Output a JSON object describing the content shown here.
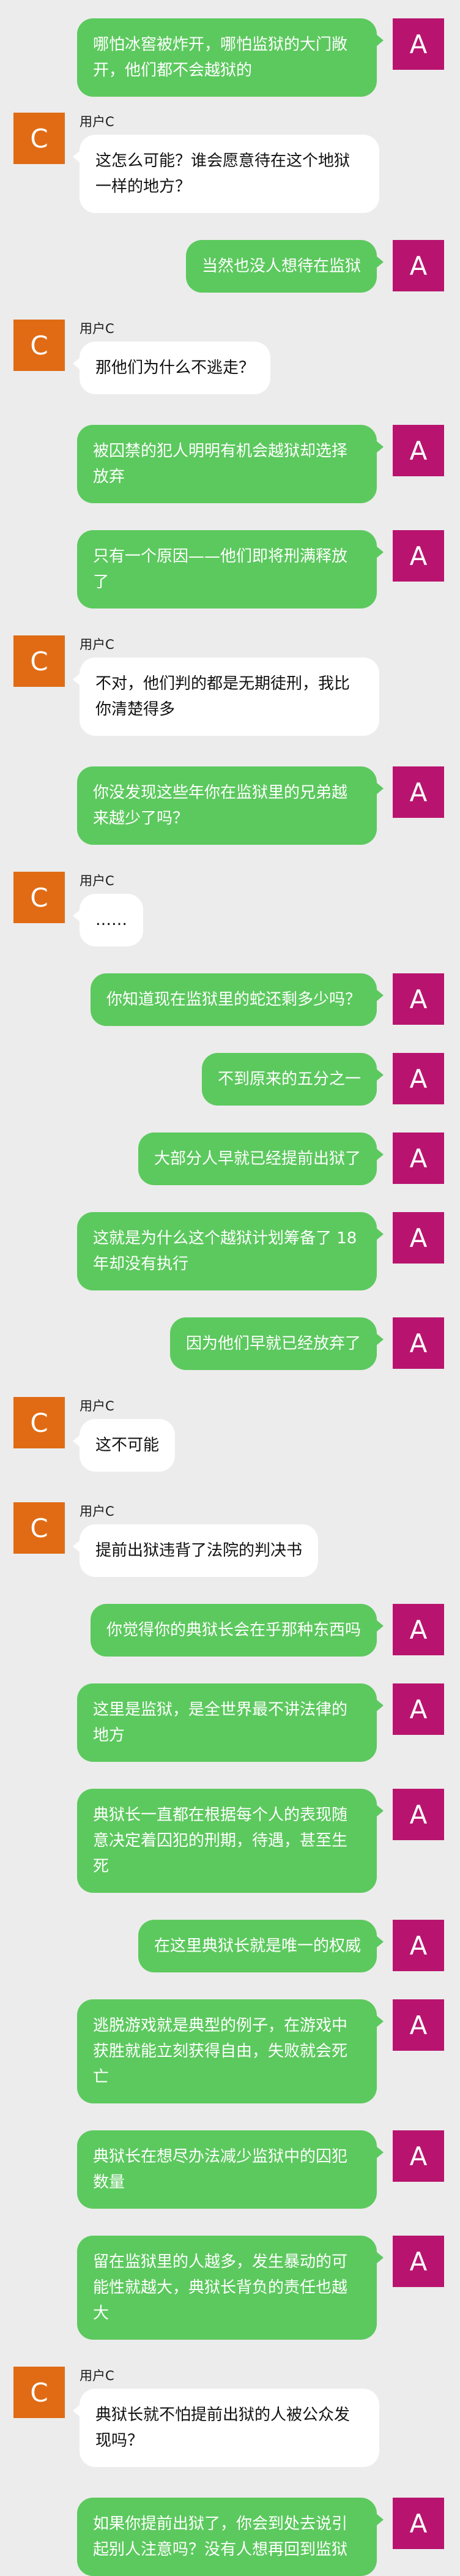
{
  "colors": {
    "background": "#ececec",
    "right_bubble": "#5cc95e",
    "left_bubble": "#ffffff",
    "avatar_a": "#b8146f",
    "avatar_c": "#e06b14"
  },
  "messages": [
    {
      "side": "right",
      "avatar": "A",
      "text": "哪怕冰窖被炸开，哪怕监狱的大门敞开，他们都不会越狱的"
    },
    {
      "side": "left",
      "avatar": "C",
      "name": "用户C",
      "text": "这怎么可能？谁会愿意待在这个地狱一样的地方？"
    },
    {
      "side": "right",
      "avatar": "A",
      "text": "当然也没人想待在监狱"
    },
    {
      "side": "left",
      "avatar": "C",
      "name": "用户C",
      "text": "那他们为什么不逃走？"
    },
    {
      "side": "right",
      "avatar": "A",
      "text": "被囚禁的犯人明明有机会越狱却选择放弃"
    },
    {
      "side": "right",
      "avatar": "A",
      "text": "只有一个原因——他们即将刑满释放了"
    },
    {
      "side": "left",
      "avatar": "C",
      "name": "用户C",
      "text": "不对，他们判的都是无期徒刑，我比你清楚得多"
    },
    {
      "side": "right",
      "avatar": "A",
      "text": "你没发现这些年你在监狱里的兄弟越来越少了吗？"
    },
    {
      "side": "left",
      "avatar": "C",
      "name": "用户C",
      "text": "……"
    },
    {
      "side": "right",
      "avatar": "A",
      "text": "你知道现在监狱里的蛇还剩多少吗？"
    },
    {
      "side": "right",
      "avatar": "A",
      "text": "不到原来的五分之一"
    },
    {
      "side": "right",
      "avatar": "A",
      "text": "大部分人早就已经提前出狱了"
    },
    {
      "side": "right",
      "avatar": "A",
      "text": "这就是为什么这个越狱计划筹备了 18 年却没有执行"
    },
    {
      "side": "right",
      "avatar": "A",
      "text": "因为他们早就已经放弃了"
    },
    {
      "side": "left",
      "avatar": "C",
      "name": "用户C",
      "text": "这不可能"
    },
    {
      "side": "left",
      "avatar": "C",
      "name": "用户C",
      "text": "提前出狱违背了法院的判决书"
    },
    {
      "side": "right",
      "avatar": "A",
      "text": "你觉得你的典狱长会在乎那种东西吗"
    },
    {
      "side": "right",
      "avatar": "A",
      "text": "这里是监狱，是全世界最不讲法律的地方"
    },
    {
      "side": "right",
      "avatar": "A",
      "text": "典狱长一直都在根据每个人的表现随意决定着囚犯的刑期，待遇，甚至生死"
    },
    {
      "side": "right",
      "avatar": "A",
      "text": "在这里典狱长就是唯一的权威"
    },
    {
      "side": "right",
      "avatar": "A",
      "text": "逃脱游戏就是典型的例子，在游戏中获胜就能立刻获得自由，失败就会死亡"
    },
    {
      "side": "right",
      "avatar": "A",
      "text": "典狱长在想尽办法减少监狱中的囚犯数量"
    },
    {
      "side": "right",
      "avatar": "A",
      "text": "留在监狱里的人越多，发生暴动的可能性就越大，典狱长背负的责任也越大"
    },
    {
      "side": "left",
      "avatar": "C",
      "name": "用户C",
      "text": "典狱长就不怕提前出狱的人被公众发现吗？"
    },
    {
      "side": "right",
      "avatar": "A",
      "text": "如果你提前出狱了，你会到处去说引起别人注意吗？没有人想再回到监狱"
    }
  ]
}
